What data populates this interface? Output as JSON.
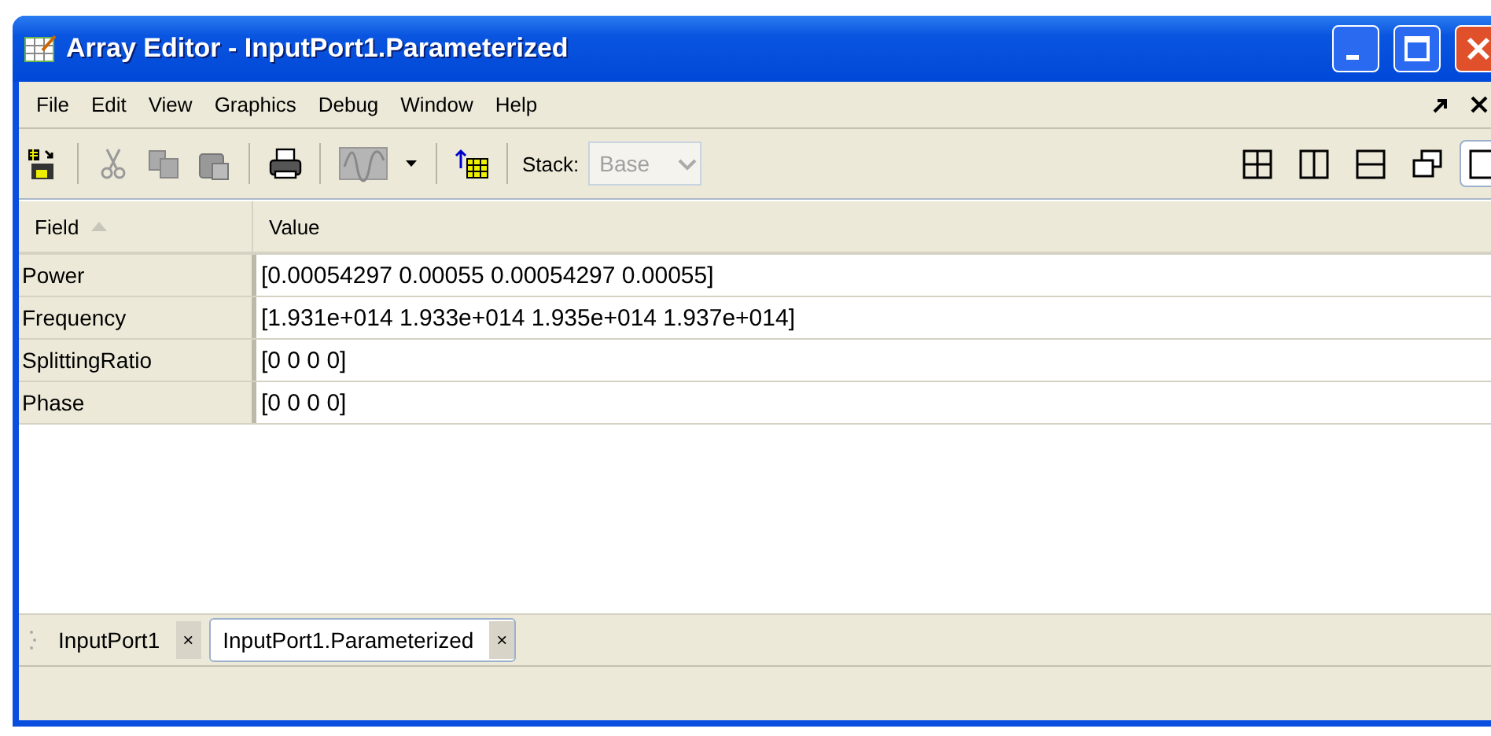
{
  "window": {
    "title": "Array Editor - InputPort1.Parameterized"
  },
  "menu": [
    "File",
    "Edit",
    "View",
    "Graphics",
    "Debug",
    "Window",
    "Help"
  ],
  "toolbar": {
    "stack_label": "Stack:",
    "stack_value": "Base",
    "stack_disabled": true
  },
  "layout_buttons": [
    {
      "kind": "grid",
      "selected": false
    },
    {
      "kind": "columns",
      "selected": false
    },
    {
      "kind": "rows",
      "selected": false
    },
    {
      "kind": "float",
      "selected": false
    },
    {
      "kind": "single",
      "selected": true
    }
  ],
  "table": {
    "columns": [
      "Field",
      "Value"
    ],
    "rows": [
      {
        "field": "Power",
        "value": "[0.00054297 0.00055 0.00054297 0.00055]"
      },
      {
        "field": "Frequency",
        "value": "[1.931e+014 1.933e+014 1.935e+014 1.937e+014]"
      },
      {
        "field": "SplittingRatio",
        "value": "[0 0 0 0]"
      },
      {
        "field": "Phase",
        "value": "[0 0 0 0]"
      }
    ]
  },
  "tabs": [
    {
      "label": "InputPort1",
      "close": "×",
      "selected": false
    },
    {
      "label": "InputPort1.Parameterized",
      "close": "×",
      "selected": true
    }
  ]
}
